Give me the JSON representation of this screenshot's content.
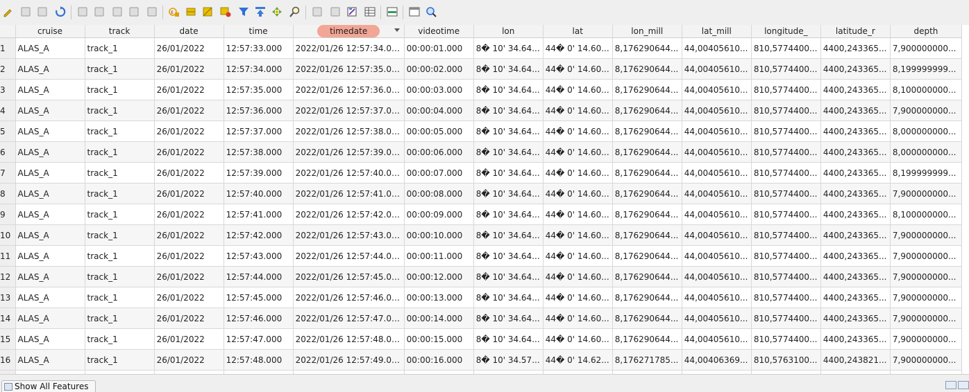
{
  "toolbar": {
    "buttons": [
      {
        "name": "edit-pencil-icon",
        "color": "#e0b000"
      },
      {
        "name": "multi-edit-icon",
        "color": "#9a9a9a"
      },
      {
        "name": "save-edits-icon",
        "color": "#9a9a9a"
      },
      {
        "name": "reload-icon",
        "color": "#2f6fd6"
      },
      {
        "name": "add-feature-icon",
        "color": "#9a9a9a"
      },
      {
        "name": "delete-feature-icon",
        "color": "#9a9a9a"
      },
      {
        "name": "cut-icon",
        "color": "#9a9a9a"
      },
      {
        "name": "copy-icon",
        "color": "#9a9a9a"
      },
      {
        "name": "paste-icon",
        "color": "#9a9a9a"
      },
      {
        "name": "select-by-expression-icon",
        "color": "#e0a000"
      },
      {
        "name": "select-all-icon",
        "color": "#e8c000"
      },
      {
        "name": "invert-selection-icon",
        "color": "#e8c000"
      },
      {
        "name": "deselect-all-icon",
        "color": "#e8c000"
      },
      {
        "name": "filter-icon",
        "color": "#2f6fd6"
      },
      {
        "name": "move-selection-to-top-icon",
        "color": "#3a7bd5"
      },
      {
        "name": "pan-to-selected-icon",
        "color": "#6aa33a"
      },
      {
        "name": "zoom-to-selected-icon",
        "color": "#e0a000"
      },
      {
        "name": "copy-rows-icon",
        "color": "#9a9a9a"
      },
      {
        "name": "paste-rows-icon",
        "color": "#9a9a9a"
      },
      {
        "name": "field-calculator-icon",
        "color": "#555"
      },
      {
        "name": "conditional-formatting-icon",
        "color": "#555"
      },
      {
        "name": "dock-table-icon",
        "color": "#3a9a5a"
      },
      {
        "name": "actions-icon",
        "color": "#555"
      },
      {
        "name": "zoom-map-icon",
        "color": "#2f6fd6"
      }
    ]
  },
  "table": {
    "columns": [
      "cruise",
      "track",
      "date",
      "time",
      "timedate",
      "videotime",
      "lon",
      "lat",
      "lon_mill",
      "lat_mill",
      "longitude_",
      "latitude_r",
      "depth"
    ],
    "sorted_column": "timedate",
    "rows": [
      {
        "n": "1",
        "cells": [
          "ALAS_A",
          "track_1",
          "26/01/2022",
          "12:57:33.000",
          "2022/01/26 12:57:34.000",
          "00:00:01.000",
          "8� 10' 34.64...",
          "44� 0' 14.60...",
          "8,176290644...",
          "44,00405610...",
          "810,5774400...",
          "4400,243365...",
          "7,900000000..."
        ]
      },
      {
        "n": "2",
        "cells": [
          "ALAS_A",
          "track_1",
          "26/01/2022",
          "12:57:34.000",
          "2022/01/26 12:57:35.000",
          "00:00:02.000",
          "8� 10' 34.64...",
          "44� 0' 14.60...",
          "8,176290644...",
          "44,00405610...",
          "810,5774400...",
          "4400,243365...",
          "8,199999999..."
        ]
      },
      {
        "n": "3",
        "cells": [
          "ALAS_A",
          "track_1",
          "26/01/2022",
          "12:57:35.000",
          "2022/01/26 12:57:36.000",
          "00:00:03.000",
          "8� 10' 34.64...",
          "44� 0' 14.60...",
          "8,176290644...",
          "44,00405610...",
          "810,5774400...",
          "4400,243365...",
          "8,100000000..."
        ]
      },
      {
        "n": "4",
        "cells": [
          "ALAS_A",
          "track_1",
          "26/01/2022",
          "12:57:36.000",
          "2022/01/26 12:57:37.000",
          "00:00:04.000",
          "8� 10' 34.64...",
          "44� 0' 14.60...",
          "8,176290644...",
          "44,00405610...",
          "810,5774400...",
          "4400,243365...",
          "7,900000000..."
        ]
      },
      {
        "n": "5",
        "cells": [
          "ALAS_A",
          "track_1",
          "26/01/2022",
          "12:57:37.000",
          "2022/01/26 12:57:38.000",
          "00:00:05.000",
          "8� 10' 34.64...",
          "44� 0' 14.60...",
          "8,176290644...",
          "44,00405610...",
          "810,5774400...",
          "4400,243365...",
          "8,000000000..."
        ]
      },
      {
        "n": "6",
        "cells": [
          "ALAS_A",
          "track_1",
          "26/01/2022",
          "12:57:38.000",
          "2022/01/26 12:57:39.000",
          "00:00:06.000",
          "8� 10' 34.64...",
          "44� 0' 14.60...",
          "8,176290644...",
          "44,00405610...",
          "810,5774400...",
          "4400,243365...",
          "8,000000000..."
        ]
      },
      {
        "n": "7",
        "cells": [
          "ALAS_A",
          "track_1",
          "26/01/2022",
          "12:57:39.000",
          "2022/01/26 12:57:40.000",
          "00:00:07.000",
          "8� 10' 34.64...",
          "44� 0' 14.60...",
          "8,176290644...",
          "44,00405610...",
          "810,5774400...",
          "4400,243365...",
          "8,199999999..."
        ]
      },
      {
        "n": "8",
        "cells": [
          "ALAS_A",
          "track_1",
          "26/01/2022",
          "12:57:40.000",
          "2022/01/26 12:57:41.000",
          "00:00:08.000",
          "8� 10' 34.64...",
          "44� 0' 14.60...",
          "8,176290644...",
          "44,00405610...",
          "810,5774400...",
          "4400,243365...",
          "7,900000000..."
        ]
      },
      {
        "n": "9",
        "cells": [
          "ALAS_A",
          "track_1",
          "26/01/2022",
          "12:57:41.000",
          "2022/01/26 12:57:42.000",
          "00:00:09.000",
          "8� 10' 34.64...",
          "44� 0' 14.60...",
          "8,176290644...",
          "44,00405610...",
          "810,5774400...",
          "4400,243365...",
          "8,100000000..."
        ]
      },
      {
        "n": "10",
        "cells": [
          "ALAS_A",
          "track_1",
          "26/01/2022",
          "12:57:42.000",
          "2022/01/26 12:57:43.000",
          "00:00:10.000",
          "8� 10' 34.64...",
          "44� 0' 14.60...",
          "8,176290644...",
          "44,00405610...",
          "810,5774400...",
          "4400,243365...",
          "7,900000000..."
        ]
      },
      {
        "n": "11",
        "cells": [
          "ALAS_A",
          "track_1",
          "26/01/2022",
          "12:57:43.000",
          "2022/01/26 12:57:44.000",
          "00:00:11.000",
          "8� 10' 34.64...",
          "44� 0' 14.60...",
          "8,176290644...",
          "44,00405610...",
          "810,5774400...",
          "4400,243365...",
          "7,900000000..."
        ]
      },
      {
        "n": "12",
        "cells": [
          "ALAS_A",
          "track_1",
          "26/01/2022",
          "12:57:44.000",
          "2022/01/26 12:57:45.000",
          "00:00:12.000",
          "8� 10' 34.64...",
          "44� 0' 14.60...",
          "8,176290644...",
          "44,00405610...",
          "810,5774400...",
          "4400,243365...",
          "7,900000000..."
        ]
      },
      {
        "n": "13",
        "cells": [
          "ALAS_A",
          "track_1",
          "26/01/2022",
          "12:57:45.000",
          "2022/01/26 12:57:46.000",
          "00:00:13.000",
          "8� 10' 34.64...",
          "44� 0' 14.60...",
          "8,176290644...",
          "44,00405610...",
          "810,5774400...",
          "4400,243365...",
          "7,900000000..."
        ]
      },
      {
        "n": "14",
        "cells": [
          "ALAS_A",
          "track_1",
          "26/01/2022",
          "12:57:46.000",
          "2022/01/26 12:57:47.000",
          "00:00:14.000",
          "8� 10' 34.64...",
          "44� 0' 14.60...",
          "8,176290644...",
          "44,00405610...",
          "810,5774400...",
          "4400,243365...",
          "7,900000000..."
        ]
      },
      {
        "n": "15",
        "cells": [
          "ALAS_A",
          "track_1",
          "26/01/2022",
          "12:57:47.000",
          "2022/01/26 12:57:48.000",
          "00:00:15.000",
          "8� 10' 34.64...",
          "44� 0' 14.60...",
          "8,176290644...",
          "44,00405610...",
          "810,5774400...",
          "4400,243365...",
          "7,900000000..."
        ]
      },
      {
        "n": "16",
        "cells": [
          "ALAS_A",
          "track_1",
          "26/01/2022",
          "12:57:48.000",
          "2022/01/26 12:57:49.000",
          "00:00:16.000",
          "8� 10' 34.57...",
          "44� 0' 14.62...",
          "8,176271785...",
          "44,00406369...",
          "810,5763100...",
          "4400,243821...",
          "7,900000000..."
        ]
      }
    ]
  },
  "footer": {
    "show_all_label": "Show All Features"
  }
}
